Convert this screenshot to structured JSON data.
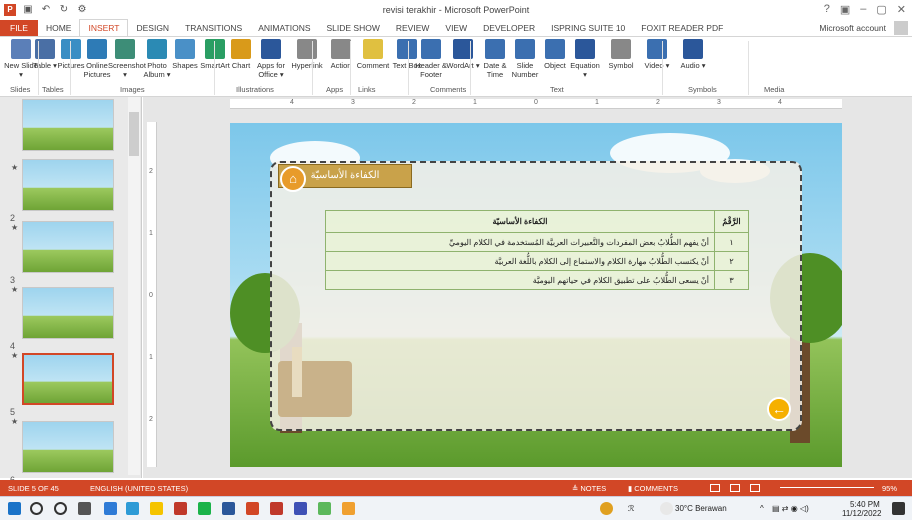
{
  "window": {
    "title": "revisi terakhir - Microsoft PowerPoint",
    "controls": [
      "?",
      "▣",
      "–",
      "▢",
      "✕"
    ]
  },
  "qat": {
    "app": "P",
    "save": "▣",
    "undo": "↶",
    "redo": "↻",
    "more": "⚙"
  },
  "tabs": [
    "FILE",
    "HOME",
    "INSERT",
    "DESIGN",
    "TRANSITIONS",
    "ANIMATIONS",
    "SLIDE SHOW",
    "REVIEW",
    "VIEW",
    "DEVELOPER",
    "ISPRING SUITE 10",
    "FOXIT READER PDF"
  ],
  "active_tab": "INSERT",
  "account": "Microsoft account",
  "ribbon": {
    "buttons": [
      "New Slide ▾",
      "Table ▾",
      "Pictures",
      "Online Pictures",
      "Screenshot ▾",
      "Photo Album ▾",
      "Shapes",
      "SmartArt",
      "Chart",
      "Apps for Office ▾",
      "Hyperlink",
      "Action",
      "Comment",
      "Text Box",
      "Header & Footer",
      "WordArt ▾",
      "Date & Time",
      "Slide Number",
      "Object",
      "Equation ▾",
      "Symbol",
      "Video ▾",
      "Audio ▾"
    ],
    "groups": [
      "Slides",
      "Tables",
      "Images",
      "Illustrations",
      "Apps",
      "Links",
      "Comments",
      "Text",
      "Symbols",
      "Media"
    ],
    "colors": {
      "accent": "#d24726"
    }
  },
  "thumbnails": [
    {
      "num": "",
      "star": "★"
    },
    {
      "num": "2",
      "star": "★"
    },
    {
      "num": "3",
      "star": "★"
    },
    {
      "num": "4",
      "star": "★"
    },
    {
      "num": "5",
      "star": "★"
    },
    {
      "num": "6",
      "star": "★"
    }
  ],
  "ruler": {
    "h_labels": [
      "4",
      "3",
      "2",
      "1",
      "0",
      "1",
      "2",
      "3",
      "4"
    ],
    "v_labels": [
      "2",
      "1",
      "0",
      "1",
      "2"
    ]
  },
  "slide": {
    "banner": "الكفاءة الأساسيّة",
    "table": {
      "headers": [
        "الرَّقْمُ",
        "الكفاءة الأساسيّة"
      ],
      "rows": [
        {
          "num": "١",
          "text": "أنْ يفهم الطُّلابُ بعض المفردات والتَّعبيرات العربيَّة المُستخدمة في الكلام اليوميِّ"
        },
        {
          "num": "٢",
          "text": "أنْ يكتسب الطُّلابُ مهارة الكلام والاستماع إلى الكلام باللُّغة العربيَّة"
        },
        {
          "num": "٣",
          "text": "أنْ يسعى الطُّلابُ على تطبيق الكلام في حياتهم اليوميَّة"
        }
      ]
    },
    "home_icon": "⌂",
    "back_icon": "←"
  },
  "statusbar": {
    "slide": "SLIDE 5 OF 45",
    "language": "ENGLISH (UNITED STATES)",
    "notes": "≜ NOTES",
    "comments": "▮ COMMENTS",
    "zoom": "95%"
  },
  "taskbar": {
    "weather": "30°C Berawan",
    "time": "5:40 PM",
    "date": "11/12/2022",
    "chevron": "^"
  }
}
